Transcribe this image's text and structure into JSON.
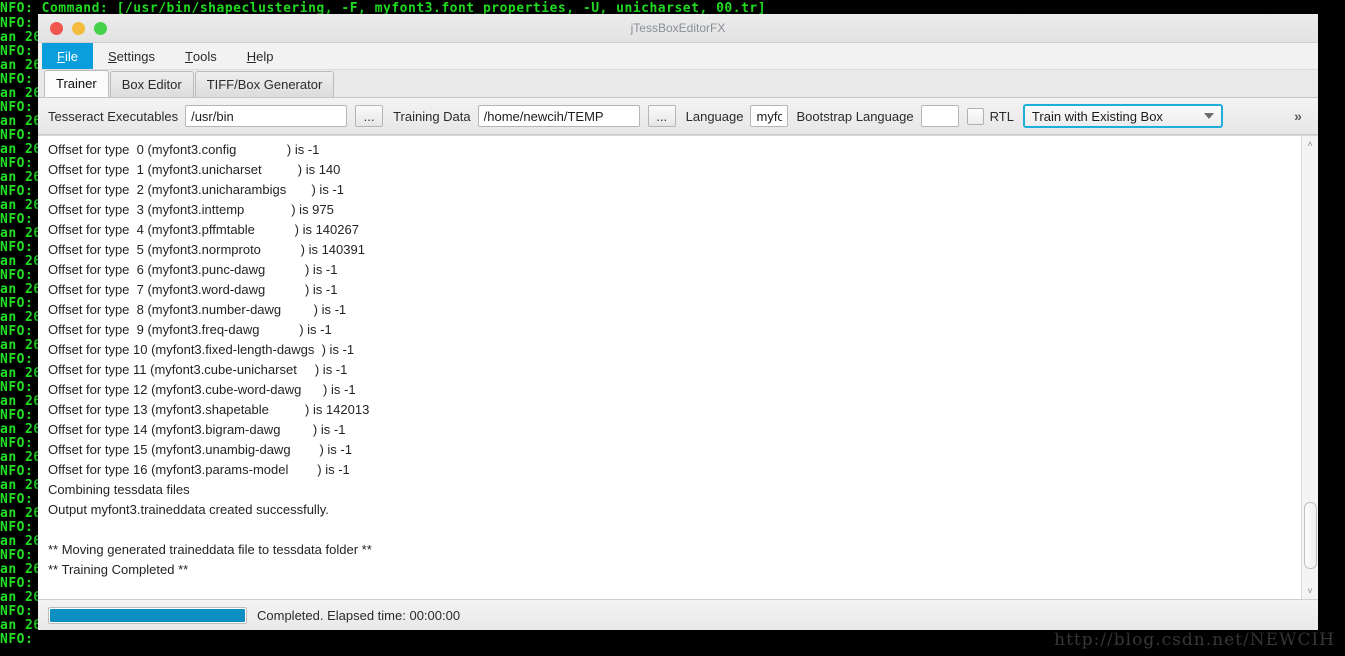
{
  "terminal": {
    "top_line": "NFO: Command: [/usr/bin/shapeclustering, -F, myfont3.font_properties, -U, unicharset, 00.tr]",
    "gutter_lines": [
      "NFO:",
      "an 26",
      "NFO:",
      "an 26",
      "NFO:",
      "an 26",
      "NFO:",
      "an 26",
      "NFO:",
      "an 26",
      "NFO:",
      "an 26",
      "NFO:",
      "an 26",
      "NFO:",
      "an 26",
      "NFO:",
      "an 26",
      "NFO:",
      "an 26",
      "NFO:",
      "an 26",
      "NFO:",
      "an 26",
      "NFO:",
      "an 26",
      "NFO:",
      "an 26",
      "NFO:",
      "an 26",
      "NFO:",
      "an 26",
      "NFO:",
      "an 26",
      "NFO:",
      "an 26",
      "NFO:",
      "an 26",
      "NFO:",
      "an 26",
      "NFO:",
      "an 26",
      "NFO:",
      "an 26",
      "NFO:"
    ],
    "watermark": "http://blog.csdn.net/NEWCIH"
  },
  "window": {
    "title": "jTessBoxEditorFX",
    "close_label": "",
    "minimize_label": "",
    "maximize_label": ""
  },
  "menubar": {
    "items": [
      {
        "label": "File",
        "mnemonic": "F",
        "rest": "ile",
        "active": true
      },
      {
        "label": "Settings",
        "mnemonic": "S",
        "rest": "ettings",
        "active": false
      },
      {
        "label": "Tools",
        "mnemonic": "T",
        "rest": "ools",
        "active": false
      },
      {
        "label": "Help",
        "mnemonic": "H",
        "rest": "elp",
        "active": false
      }
    ]
  },
  "tabs": [
    {
      "label": "Trainer",
      "selected": true
    },
    {
      "label": "Box Editor",
      "selected": false
    },
    {
      "label": "TIFF/Box Generator",
      "selected": false
    }
  ],
  "toolbar": {
    "tesseract_label": "Tesseract Executables",
    "tesseract_value": "/usr/bin",
    "tesseract_browse": "...",
    "training_label": "Training Data",
    "training_value": "/home/newcih/TEMP",
    "training_browse": "...",
    "language_label": "Language",
    "language_value": "myfo",
    "bootstrap_label": "Bootstrap Language",
    "bootstrap_value": "",
    "rtl_label": "RTL",
    "rtl_checked": false,
    "mode_value": "Train with Existing Box",
    "overflow_label": "»",
    "focus_color": "#1eaedb"
  },
  "console": {
    "lines": [
      "Offset for type  0 (myfont3.config              ) is -1",
      "Offset for type  1 (myfont3.unicharset          ) is 140",
      "Offset for type  2 (myfont3.unicharambigs       ) is -1",
      "Offset for type  3 (myfont3.inttemp             ) is 975",
      "Offset for type  4 (myfont3.pffmtable           ) is 140267",
      "Offset for type  5 (myfont3.normproto           ) is 140391",
      "Offset for type  6 (myfont3.punc-dawg           ) is -1",
      "Offset for type  7 (myfont3.word-dawg           ) is -1",
      "Offset for type  8 (myfont3.number-dawg         ) is -1",
      "Offset for type  9 (myfont3.freq-dawg           ) is -1",
      "Offset for type 10 (myfont3.fixed-length-dawgs  ) is -1",
      "Offset for type 11 (myfont3.cube-unicharset     ) is -1",
      "Offset for type 12 (myfont3.cube-word-dawg      ) is -1",
      "Offset for type 13 (myfont3.shapetable          ) is 142013",
      "Offset for type 14 (myfont3.bigram-dawg         ) is -1",
      "Offset for type 15 (myfont3.unambig-dawg        ) is -1",
      "Offset for type 16 (myfont3.params-model        ) is -1",
      "Combining tessdata files",
      "Output myfont3.traineddata created successfully.",
      "",
      "** Moving generated traineddata file to tessdata folder **",
      "** Training Completed **"
    ]
  },
  "scrollbar": {
    "up_arrow": "˄",
    "down_arrow": "˅"
  },
  "statusbar": {
    "progress_percent": 100,
    "status_text": "Completed. Elapsed time: 00:00:00",
    "progress_color": "#0d8fc4"
  }
}
